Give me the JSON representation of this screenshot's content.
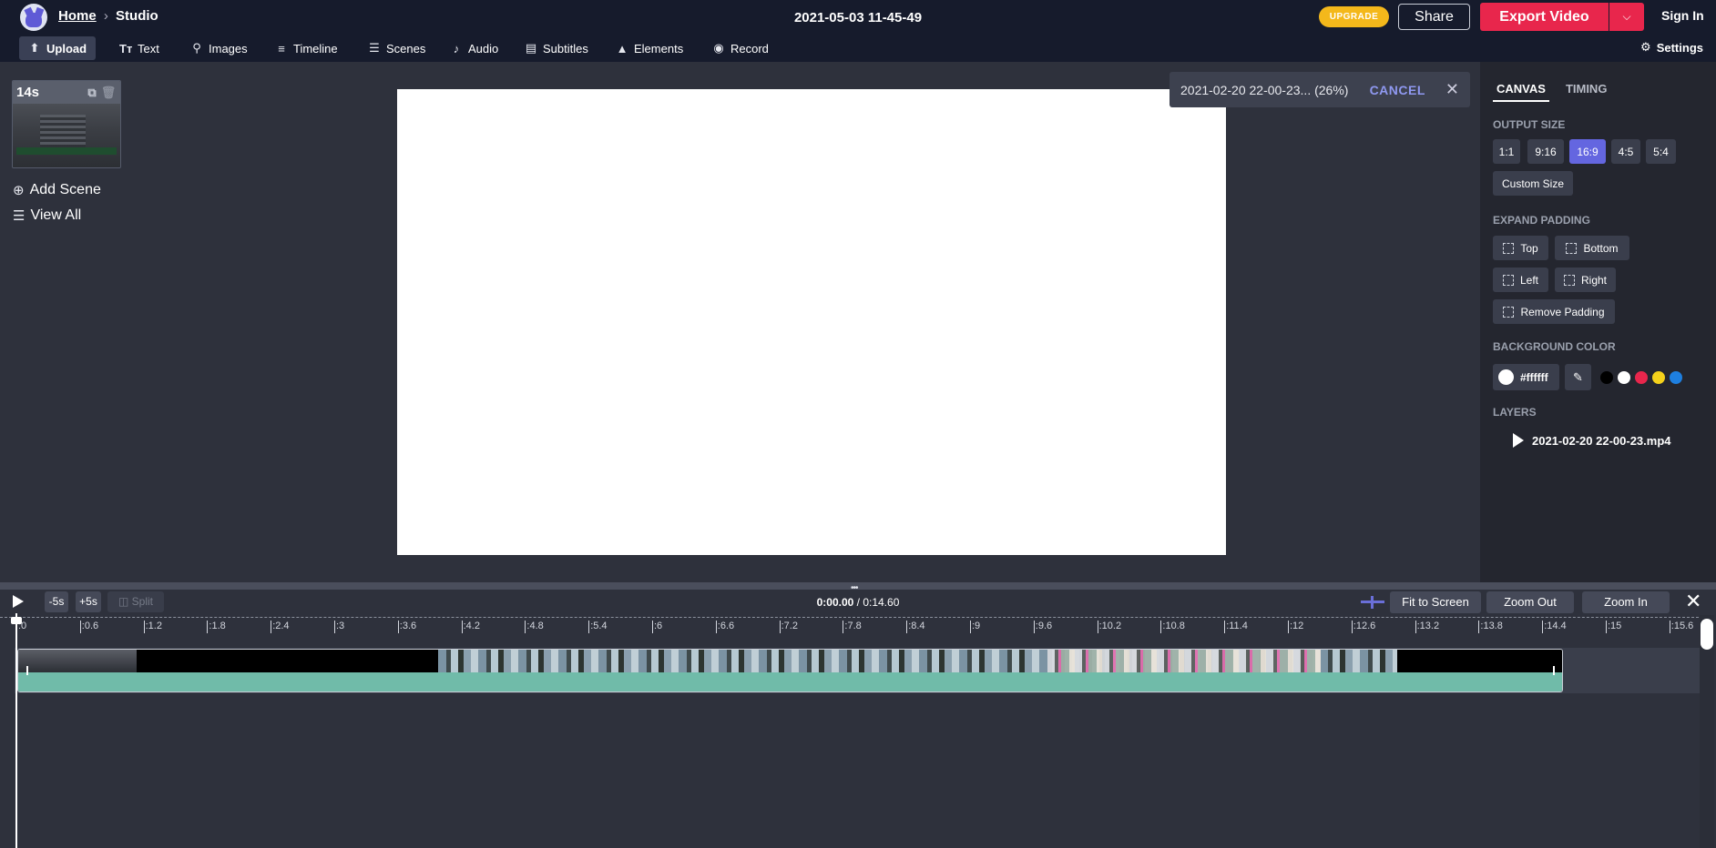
{
  "header": {
    "home": "Home",
    "crumb_sep": "›",
    "section": "Studio",
    "project_title": "2021-05-03 11-45-49",
    "upgrade": "UPGRADE",
    "share": "Share",
    "export": "Export Video",
    "signin": "Sign In"
  },
  "toolbar": {
    "items": [
      {
        "label": "Upload",
        "icon": "upload-icon"
      },
      {
        "label": "Text",
        "icon": "text-icon"
      },
      {
        "label": "Images",
        "icon": "search-icon"
      },
      {
        "label": "Timeline",
        "icon": "timeline-icon"
      },
      {
        "label": "Scenes",
        "icon": "layers-icon"
      },
      {
        "label": "Audio",
        "icon": "music-note-icon"
      },
      {
        "label": "Subtitles",
        "icon": "subtitles-icon"
      },
      {
        "label": "Elements",
        "icon": "shapes-icon"
      },
      {
        "label": "Record",
        "icon": "record-icon"
      }
    ],
    "settings": "Settings"
  },
  "scenes": {
    "duration": "14s",
    "add_scene": "Add Scene",
    "view_all": "View All"
  },
  "toast": {
    "text": "2021-02-20 22-00-23... (26%)",
    "cancel": "CANCEL"
  },
  "right_panel": {
    "tabs": [
      "CANVAS",
      "TIMING"
    ],
    "output_size_label": "OUTPUT SIZE",
    "ratios": [
      "1:1",
      "9:16",
      "16:9",
      "4:5",
      "5:4"
    ],
    "selected_ratio": "16:9",
    "custom_size": "Custom Size",
    "expand_padding_label": "EXPAND PADDING",
    "padding": [
      "Top",
      "Bottom",
      "Left",
      "Right"
    ],
    "remove_padding": "Remove Padding",
    "background_color_label": "BACKGROUND COLOR",
    "background_color": "#ffffff",
    "swatches": [
      "#000000",
      "#ffffff",
      "#e8264c",
      "#f4d11b",
      "#1e7fe0"
    ],
    "layers_label": "LAYERS",
    "layer_name": "2021-02-20 22-00-23.mp4"
  },
  "timeline": {
    "minus5": "-5s",
    "plus5": "+5s",
    "split": "Split",
    "current_time": "0:00.00",
    "time_sep": " / ",
    "total_time": "0:14.60",
    "fit": "Fit to Screen",
    "zoom_out": "Zoom Out",
    "zoom_in": "Zoom In",
    "ticks": [
      ":0",
      ":0.6",
      ":1.2",
      ":1.8",
      ":2.4",
      ":3",
      ":3.6",
      ":4.2",
      ":4.8",
      ":5.4",
      ":6",
      ":6.6",
      ":7.2",
      ":7.8",
      ":8.4",
      ":9",
      ":9.6",
      ":10.2",
      ":10.8",
      ":11.4",
      ":12",
      ":12.6",
      ":13.2",
      ":13.8",
      ":14.4",
      ":15",
      ":15.6"
    ]
  },
  "colors": {
    "accent": "#6466e0",
    "export": "#e8264c",
    "upgrade": "#f4b81b",
    "audio_wave": "#70bba9"
  }
}
